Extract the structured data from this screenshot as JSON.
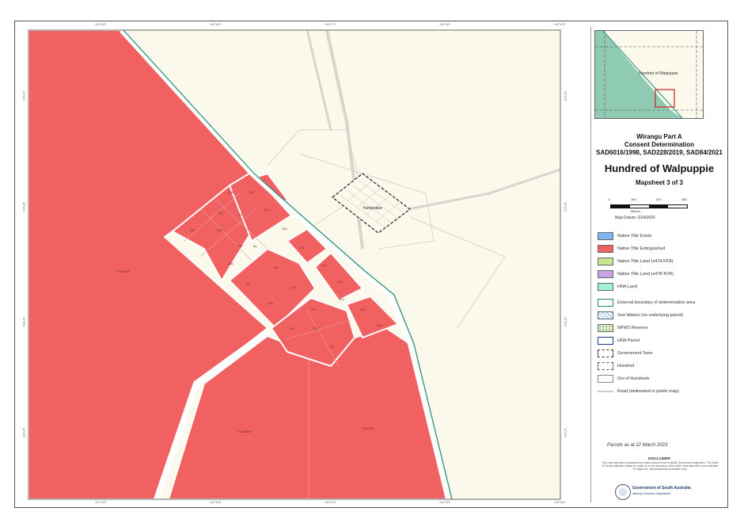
{
  "map": {
    "title_block": {
      "line1": "Wirangu Part A",
      "line2": "Consent Determination",
      "cases": "SAD6016/1998, SAD228/2019, SAD84/2021",
      "hundred": "Hundred of Walpuppie",
      "mapsheet": "Mapsheet 3 of 3"
    },
    "inset": {
      "label": "Hundred of Walpuppie"
    },
    "scale": {
      "ticks": [
        "0",
        "160",
        "320",
        "480"
      ],
      "unit": "Metres",
      "datum": "Map Datum: GDA2020"
    },
    "town_label": "Yantanabie",
    "parcel_labels": {
      "left_large": "F218005",
      "bottom_mid": "D118890",
      "bottom_right": "D34426",
      "l218": "218",
      "l219": "219",
      "l210": "210",
      "l211": "211",
      "l212": "212",
      "l215": "215",
      "l230": "230",
      "l56": "56",
      "l233": "233",
      "l231": "231",
      "l232": "232",
      "l55": "55",
      "l54": "54",
      "l228": "228",
      "l229": "229",
      "l225": "225",
      "l224": "224",
      "l222": "222",
      "l223": "223",
      "l226": "226",
      "l227": "227",
      "l220": "220",
      "l221": "221",
      "l213": "213",
      "l217": "217"
    },
    "ticks_top": [
      "134°15'E",
      "134°16'E",
      "134°17'E",
      "134°18'E",
      "134°19'E"
    ],
    "ticks_bottom": [
      "134°15'E",
      "134°16'E",
      "134°17'E",
      "134°18'E",
      "134°19'E"
    ],
    "ticks_left": [
      "32°31'S",
      "32°32'S",
      "32°33'S",
      "32°34'S"
    ],
    "ticks_right": [
      "32°31'S",
      "32°32'S",
      "32°33'S",
      "32°34'S"
    ]
  },
  "legend": [
    {
      "label": "Native Title Exists",
      "color": "#7fb6f2"
    },
    {
      "label": "Native Title Extinguished",
      "color": "#f26161"
    },
    {
      "label": "Native Title Land (s47A NTA)",
      "color": "#c8e68f"
    },
    {
      "label": "Native Title Land (s47B NTA)",
      "color": "#c9a3e6"
    },
    {
      "label": "HNA Land",
      "color": "#9ff0d6"
    },
    {
      "label": "External boundary of determination area",
      "color": "#1f8a7a"
    },
    {
      "label": "Sea Waters (no underlying parcel)",
      "color": "#b7d6f0"
    },
    {
      "label": "NPWS Reserve",
      "color": "#e0efd0"
    },
    {
      "label": "HNA Parcel",
      "color": "#1c3c8c"
    },
    {
      "label": "Government Town",
      "color": "#333333"
    },
    {
      "label": "Hundred",
      "color": "#555555"
    },
    {
      "label": "Out of Hundreds",
      "color": "#888888"
    },
    {
      "label": "Road (delineated in public map)",
      "color": "#cccccc"
    }
  ],
  "footer": {
    "parcels_date": "Parcels as at 22 March 2023",
    "disclaimer_title": "DISCLAIMER",
    "disclaimer_text": "This map has been produced from data sourced from multiple Government agencies. The State of South Australia makes no claim as to the accuracy of the data. Data depicted is not intended for legal use. Boundaries are indicative only.",
    "gov_name": "Government of South Australia",
    "gov_dept": "Attorney-General's Department"
  },
  "colors": {
    "extinguished": "#f26161",
    "background": "#fbf9ec",
    "road": "#ffffff",
    "boundary": "#1f8a7a"
  }
}
